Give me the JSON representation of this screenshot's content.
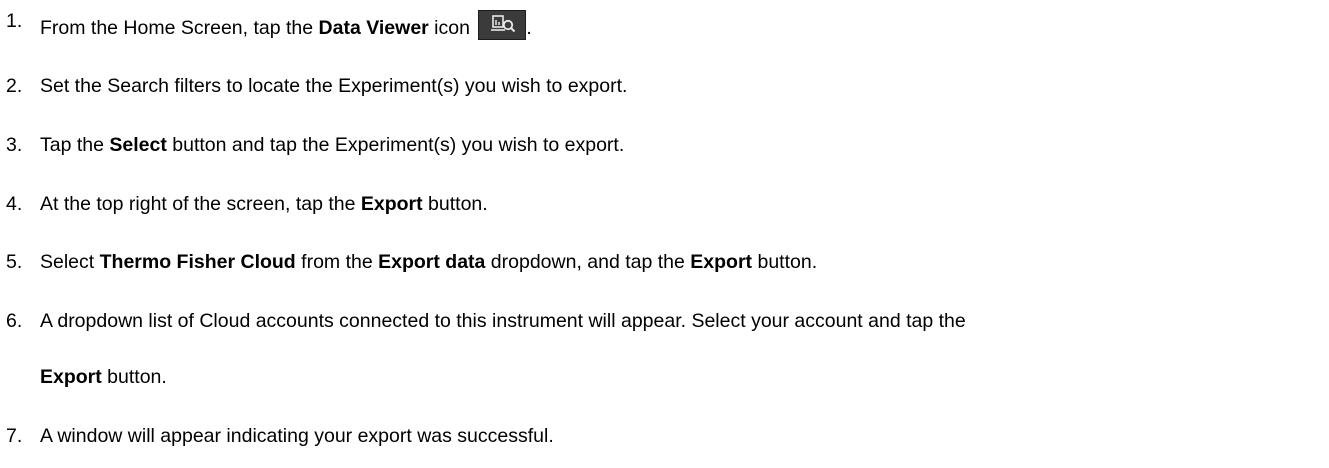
{
  "steps": [
    {
      "num": "1.",
      "parts": [
        "From the Home Screen, tap the ",
        "Data Viewer",
        " icon ",
        "."
      ],
      "icon": "data-viewer-icon"
    },
    {
      "num": "2.",
      "text": "Set the Search filters to locate the Experiment(s) you wish to export."
    },
    {
      "num": "3.",
      "parts": [
        "Tap the ",
        "Select",
        " button and tap the Experiment(s) you wish to export."
      ]
    },
    {
      "num": "4.",
      "parts": [
        "At the top right of the screen, tap the ",
        "Export",
        " button."
      ]
    },
    {
      "num": "5.",
      "parts": [
        "Select ",
        "Thermo Fisher Cloud",
        " from the ",
        "Export data",
        " dropdown, and tap the ",
        "Export",
        " button."
      ]
    },
    {
      "num": "6.",
      "text": "A dropdown list of Cloud accounts connected to this instrument will appear. Select your account and tap the",
      "continuation": [
        "Export",
        " button."
      ]
    },
    {
      "num": "7.",
      "text": "A window will appear indicating your export was successful."
    }
  ],
  "icon_colors": {
    "background": "#3b3b3b",
    "glyph": "#e8e8e8"
  }
}
